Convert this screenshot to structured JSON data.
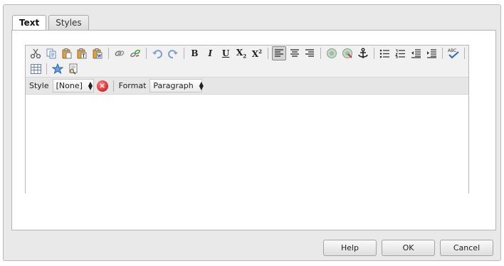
{
  "tabs": [
    {
      "label": "Text",
      "active": true
    },
    {
      "label": "Styles",
      "active": false
    }
  ],
  "toolbar": {
    "row1": [
      "cut-icon",
      "copy-icon",
      "paste-icon",
      "paste-text-icon",
      "paste-word-icon",
      "link-icon",
      "unlink-icon",
      "undo-icon",
      "redo-icon",
      "bold",
      "italic",
      "underline",
      "subscript",
      "superscript",
      "align-left-icon",
      "align-center-icon",
      "align-right-icon",
      "image-icon",
      "image-map-icon",
      "anchor-icon",
      "bulleted-list-icon",
      "numbered-list-icon",
      "outdent-icon",
      "indent-icon",
      "spellcheck-icon"
    ],
    "row2": [
      "table-icon",
      "special-chars-icon",
      "find-replace-icon"
    ],
    "labels": {
      "bold": "B",
      "italic": "I",
      "underline": "U",
      "subscript_base": "X",
      "subscript_mark": "2",
      "superscript_base": "X",
      "superscript_mark": "2",
      "spellcheck_text": "ABC"
    }
  },
  "format_bar": {
    "style_label": "Style",
    "style_value": "[None]",
    "clear_icon": "clear-style-icon",
    "format_label": "Format",
    "format_value": "Paragraph"
  },
  "buttons": {
    "help": "Help",
    "ok": "OK",
    "cancel": "Cancel"
  },
  "colors": {
    "dialog_bg": "#e9e9e9",
    "toolbar_bg": "#f1f1f1",
    "active_align_bg": "#d4d4d4"
  }
}
